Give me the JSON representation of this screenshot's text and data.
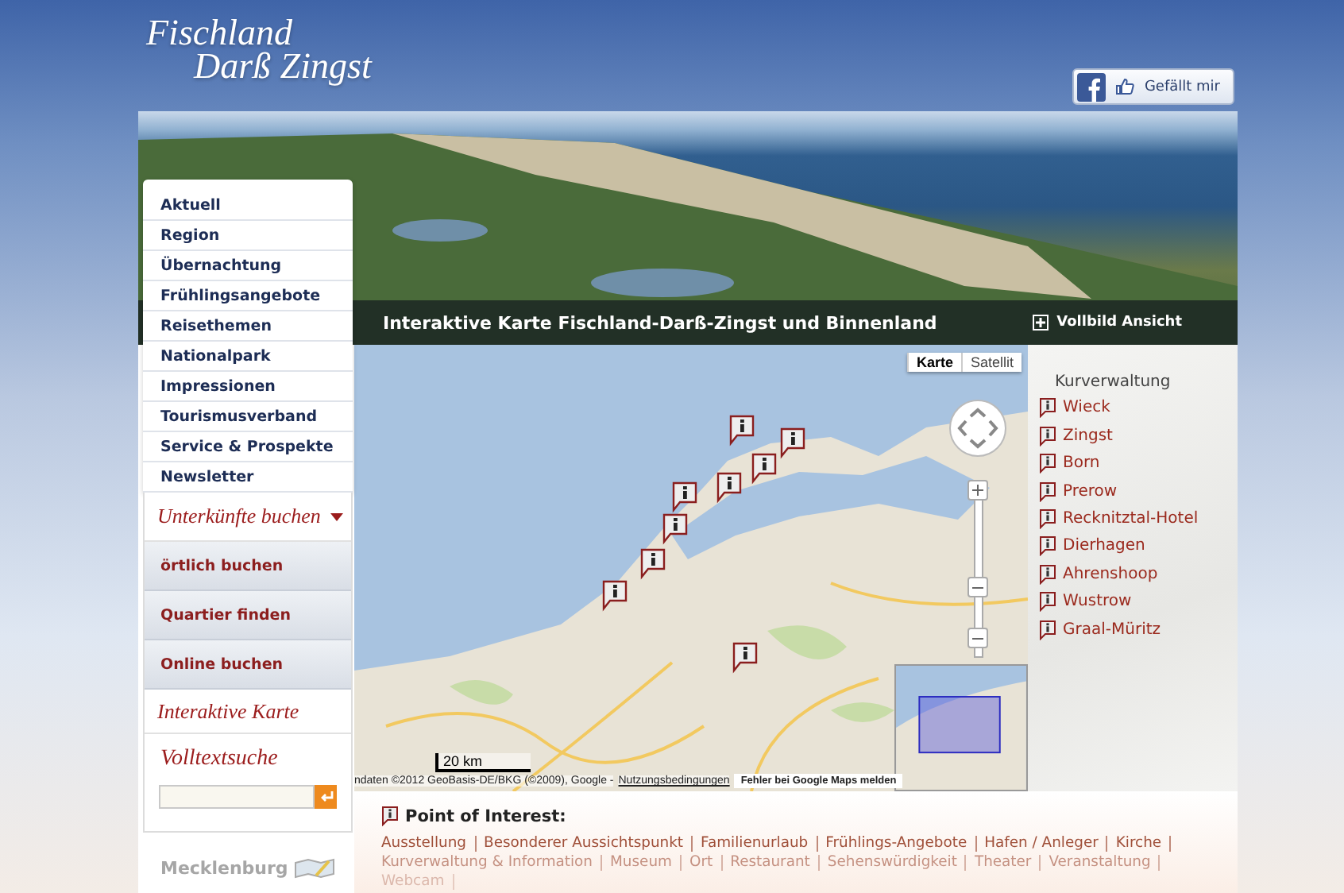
{
  "logo": {
    "line_1": "Fischland",
    "line_2": "Darß Zingst"
  },
  "facebook": {
    "label": "Gefällt mir"
  },
  "banner": {
    "caption": "Interaktive Karte Fischland-Darß-Zingst und Binnenland",
    "fullscreen": "Vollbild Ansicht"
  },
  "nav": [
    "Aktuell",
    "Region",
    "Übernachtung",
    "Frühlingsangebote",
    "Reisethemen",
    "Nationalpark",
    "Impressionen",
    "Tourismusverband",
    "Service & Prospekte",
    "Newsletter"
  ],
  "booking": {
    "title": "Unterkünfte buchen",
    "expanded": true,
    "items": [
      "örtlich buchen",
      "Quartier finden",
      "Online buchen"
    ]
  },
  "map_link": "Interaktive Karte",
  "search": {
    "title": "Volltextsuche"
  },
  "partner": "Mecklenburg",
  "map": {
    "tabs": [
      {
        "label": "Karte",
        "selected": true
      },
      {
        "label": "Satellit",
        "selected": false
      }
    ],
    "scale": "20 km",
    "attribution": "ndaten ©2012 GeoBasis-DE/BKG (©2009), Google -",
    "terms_link": "Nutzungsbedingungen",
    "report_link": "Fehler bei Google Maps melden"
  },
  "locations": {
    "title": "Kurverwaltung",
    "items": [
      "Wieck",
      "Zingst",
      "Born",
      "Prerow",
      "Recknitztal-Hotel",
      "Dierhagen",
      "Ahrenshoop",
      "Wustrow",
      "Graal-Müritz"
    ]
  },
  "poi": {
    "title": "Point of Interest:",
    "links": [
      "Ausstellung",
      "Besonderer Aussichtspunkt",
      "Familienurlaub",
      "Frühlings-Angebote",
      "Hafen / Anleger",
      "Kirche",
      "Kurverwaltung & Information",
      "Museum",
      "Ort",
      "Restaurant",
      "Sehenswürdigkeit",
      "Theater",
      "Veranstaltung",
      "Webcam"
    ]
  }
}
